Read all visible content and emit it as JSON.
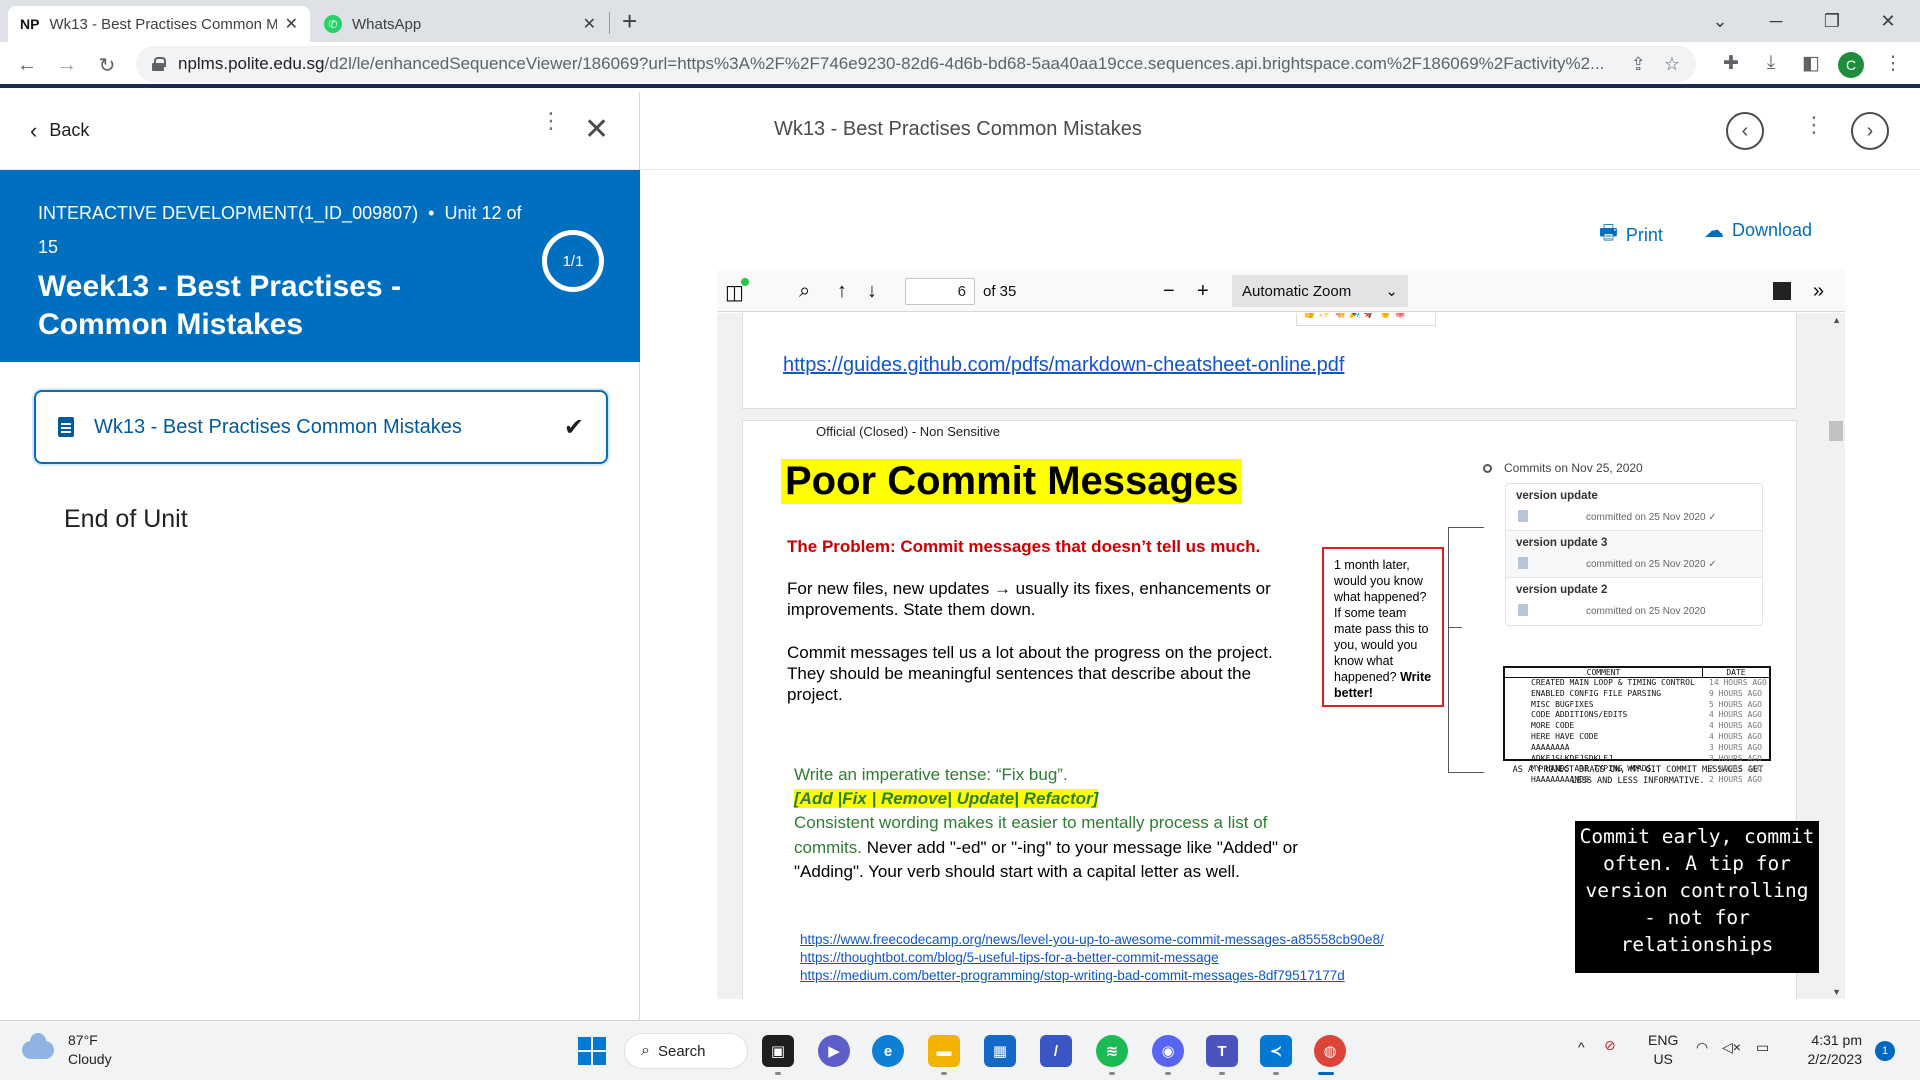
{
  "browser": {
    "tabs": [
      {
        "favicon": "NP",
        "title": "Wk13 - Best Practises Common Mistakes"
      },
      {
        "favicon": "whatsapp-icon",
        "title": "WhatsApp"
      }
    ],
    "url_host": "nplms.polite.edu.sg",
    "url_path": "/d2l/le/enhancedSequenceViewer/186069?url=https%3A%2F%2F746e9230-82d6-4d6b-bd68-5aa40aa19cce.sequences.api.brightspace.com%2F186069%2Factivity%2...",
    "profile_initial": "C"
  },
  "left_panel": {
    "back_label": "Back",
    "course": "INTERACTIVE DEVELOPMENT(1_ID_009807)",
    "unit": "Unit 12 of 15",
    "unit_title": "Week13 - Best Practises - Common Mistakes",
    "progress": "1/1",
    "topic": "Wk13 - Best Practises Common Mistakes",
    "end_label": "End of Unit"
  },
  "right_panel": {
    "title": "Wk13 - Best Practises Common Mistakes",
    "print_label": "Print",
    "download_label": "Download"
  },
  "pdf_viewer": {
    "page_number": "6",
    "page_count": "of 35",
    "zoom": "Automatic Zoom"
  },
  "pdf_content": {
    "prev_link": "https://guides.github.com/pdfs/markdown-cheatsheet-online.pdf",
    "classification": "Official (Closed) - Non Sensitive",
    "slide_title": "Poor Commit Messages",
    "problem": "The Problem: Commit messages that doesn’t tell us much.",
    "para1": "For new files, new updates → usually its fixes, enhancements or improvements. State them down.",
    "para2": "Commit messages tell us a lot about the progress on the project. They should be meaningful sentences that describe about the project.",
    "callout_text": "1 month later, would you know what happened? If some team mate pass this to you, would you know what happened?",
    "callout_bold": "Write better!",
    "tip_line1": "Write an imperative tense: “Fix bug”.",
    "tip_keywords": "[Add |Fix | Remove| Update| Refactor]",
    "tip_line3_green": "Consistent wording makes it easier to mentally process a list of commits.",
    "tip_line3_black": " Never add \"-ed\" or \"-ing\" to your message like \"Added\" or \"Adding\". Your verb should start with a capital letter as well.",
    "refs": [
      "https://www.freecodecamp.org/news/level-you-up-to-awesome-commit-messages-a85558cb90e8/",
      "https://thoughtbot.com/blog/5-useful-tips-for-a-better-commit-message",
      "https://medium.com/better-programming/stop-writing-bad-commit-messages-8df79517177d"
    ],
    "commits_header": "Commits on Nov 25, 2020",
    "commits": [
      {
        "message": "version update",
        "meta": "committed on 25 Nov 2020 ✓"
      },
      {
        "message": "version update 3",
        "meta": "committed on 25 Nov 2020 ✓"
      },
      {
        "message": "version update 2",
        "meta": "committed on 25 Nov 2020"
      }
    ],
    "xkcd_head": {
      "comment": "COMMENT",
      "date": "DATE"
    },
    "xkcd_rows": [
      {
        "c": "CREATED MAIN LOOP & TIMING CONTROL",
        "d": "14 HOURS AGO"
      },
      {
        "c": "ENABLED CONFIG FILE PARSING",
        "d": "9 HOURS AGO"
      },
      {
        "c": "MISC BUGFIXES",
        "d": "5 HOURS AGO"
      },
      {
        "c": "CODE ADDITIONS/EDITS",
        "d": "4 HOURS AGO"
      },
      {
        "c": "MORE CODE",
        "d": "4 HOURS AGO"
      },
      {
        "c": "HERE HAVE CODE",
        "d": "4 HOURS AGO"
      },
      {
        "c": "AAAAAAAA",
        "d": "3 HOURS AGO"
      },
      {
        "c": "ADKFJSLKDFJSDKLFJ",
        "d": "3 HOURS AGO"
      },
      {
        "c": "MY HANDS ARE TYPING WORDS",
        "d": "2 HOURS AGO"
      },
      {
        "c": "HAAAAAAAANDS",
        "d": "2 HOURS AGO"
      }
    ],
    "xkcd_caption": "AS A PROJECT DRAGS ON, MY GIT COMMIT MESSAGES GET LESS AND LESS INFORMATIVE.",
    "quote": "Commit early, commit often. A tip for version controlling - not for relationships"
  },
  "taskbar": {
    "temperature": "87°F",
    "condition": "Cloudy",
    "search_label": "Search",
    "lang1": "ENG",
    "lang2": "US",
    "time": "4:31 pm",
    "date": "2/2/2023",
    "notifications": "1"
  },
  "colors": {
    "brand_blue": "#006fbf",
    "link_blue": "#1155cc",
    "problem_red": "#cc0000",
    "tip_green": "#2e7d32",
    "highlight_yellow": "#ffff00"
  }
}
